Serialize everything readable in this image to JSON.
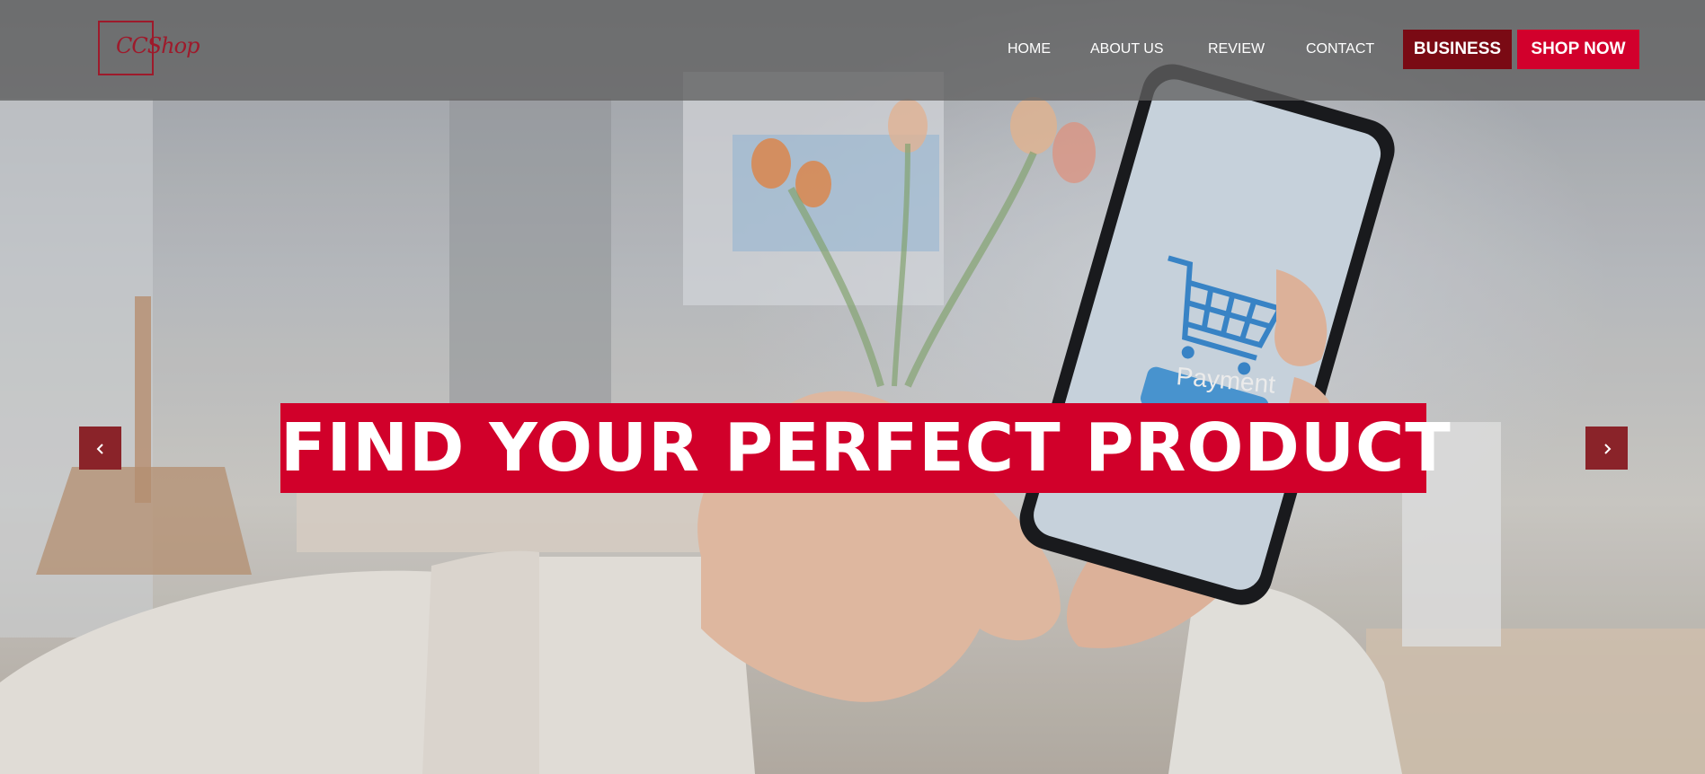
{
  "brand": {
    "logo_text": "CCShop",
    "color": "#9e1a2b"
  },
  "nav": {
    "items": [
      {
        "label": "HOME"
      },
      {
        "label": "ABOUT US"
      },
      {
        "label": "REVIEW"
      },
      {
        "label": "CONTACT"
      }
    ],
    "business_label": "BUSINESS",
    "shop_label": "SHOP NOW"
  },
  "hero": {
    "headline": "FIND YOUR PERFECT PRODUCT",
    "phone_button_text": "Payment",
    "prev_icon": "chevron-left-icon",
    "next_icon": "chevron-right-icon"
  },
  "colors": {
    "accent": "#d1002a",
    "dark_accent": "#7a0a14",
    "arrow_bg": "#8a2329"
  }
}
